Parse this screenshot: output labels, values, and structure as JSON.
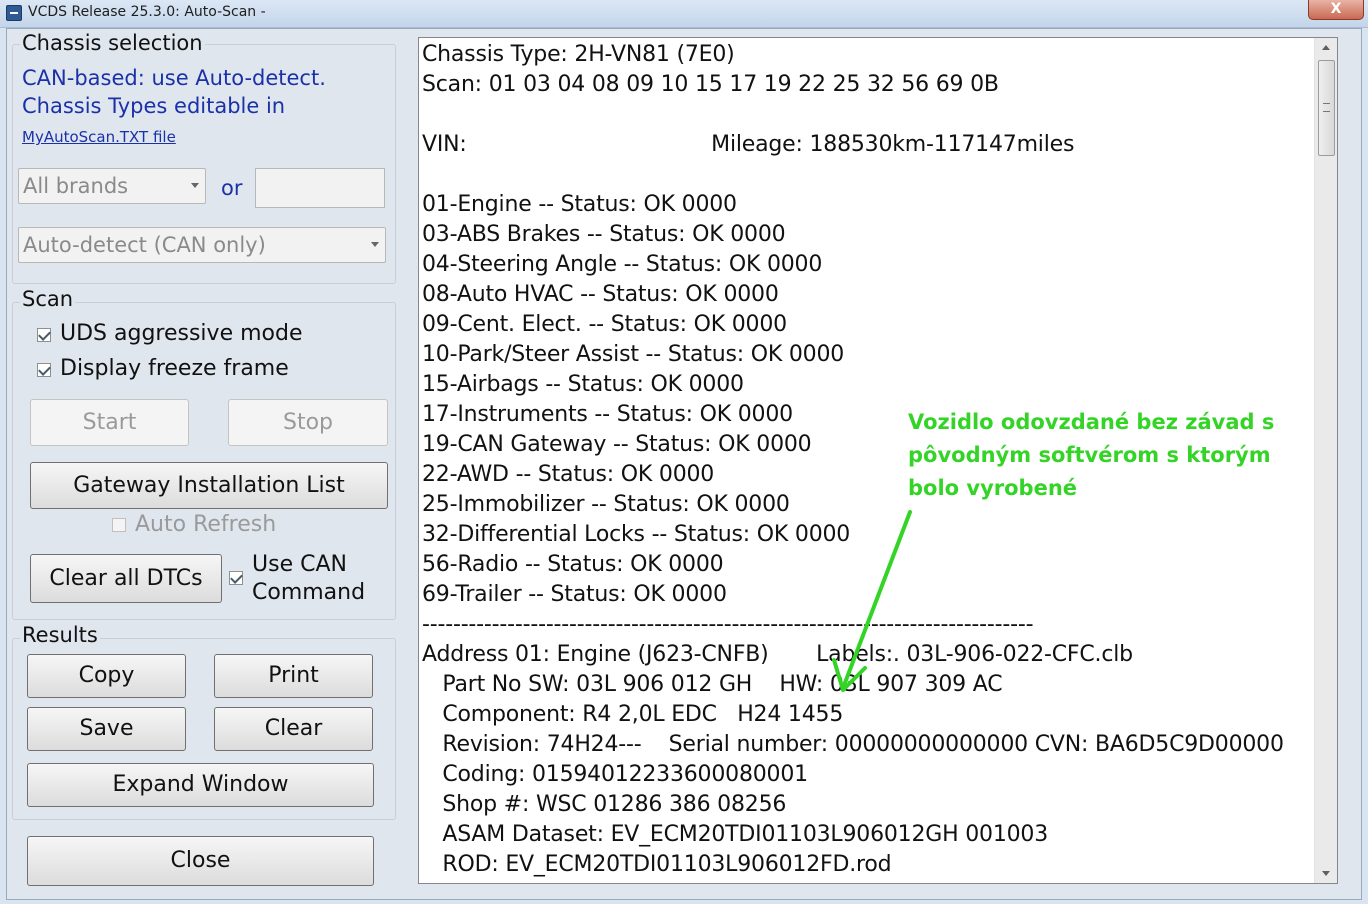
{
  "window": {
    "title": "VCDS Release 25.3.0:  Auto-Scan -",
    "close_label": "X"
  },
  "chassis": {
    "group_title": "Chassis selection",
    "info_line1": "CAN-based: use Auto-detect.",
    "info_line2": "Chassis Types editable in",
    "link": "MyAutoScan.TXT file",
    "brand_select": "All brands",
    "or_label": "or",
    "chassis_text": "",
    "detect_select": "Auto-detect (CAN only)"
  },
  "scan": {
    "group_title": "Scan",
    "uds_label": "UDS aggressive mode",
    "freeze_label": "Display freeze frame",
    "start_label": "Start",
    "stop_label": "Stop",
    "gateway_label": "Gateway Installation List",
    "auto_refresh_label": "Auto Refresh",
    "clear_dtcs_label": "Clear all DTCs",
    "use_can_line1": "Use CAN",
    "use_can_line2": "Command"
  },
  "results": {
    "group_title": "Results",
    "copy_label": "Copy",
    "print_label": "Print",
    "save_label": "Save",
    "clear_label": "Clear",
    "expand_label": "Expand Window",
    "close_label": "Close"
  },
  "log": {
    "lines": [
      "Chassis Type: 2H-VN81 (7E0)",
      "Scan: 01 03 04 08 09 10 15 17 19 22 25 32 56 69 0B",
      "",
      "VIN:                                    Mileage: 188530km-117147miles",
      "",
      "01-Engine -- Status: OK 0000",
      "03-ABS Brakes -- Status: OK 0000",
      "04-Steering Angle -- Status: OK 0000",
      "08-Auto HVAC -- Status: OK 0000",
      "09-Cent. Elect. -- Status: OK 0000",
      "10-Park/Steer Assist -- Status: OK 0000",
      "15-Airbags -- Status: OK 0000",
      "17-Instruments -- Status: OK 0000",
      "19-CAN Gateway -- Status: OK 0000",
      "22-AWD -- Status: OK 0000",
      "25-Immobilizer -- Status: OK 0000",
      "32-Differential Locks -- Status: OK 0000",
      "56-Radio -- Status: OK 0000",
      "69-Trailer -- Status: OK 0000",
      "-------------------------------------------------------------------------------",
      "Address 01: Engine (J623-CNFB)       Labels:. 03L-906-022-CFC.clb",
      "   Part No SW: 03L 906 012 GH    HW: 03L 907 309 AC",
      "   Component: R4 2,0L EDC   H24 1455",
      "   Revision: 74H24---    Serial number: 00000000000000 CVN: BA6D5C9D00000",
      "   Coding: 01594012233600080001",
      "   Shop #: WSC 01286 386 08256",
      "   ASAM Dataset: EV_ECM20TDI01103L906012GH 001003",
      "   ROD: EV_ECM20TDI01103L906012FD.rod"
    ]
  },
  "annotation": {
    "line1": "Vozidlo odovzdané bez závad s",
    "line2": "pôvodným softvérom s ktorým",
    "line3": "bolo vyrobené",
    "color": "#34d427"
  }
}
